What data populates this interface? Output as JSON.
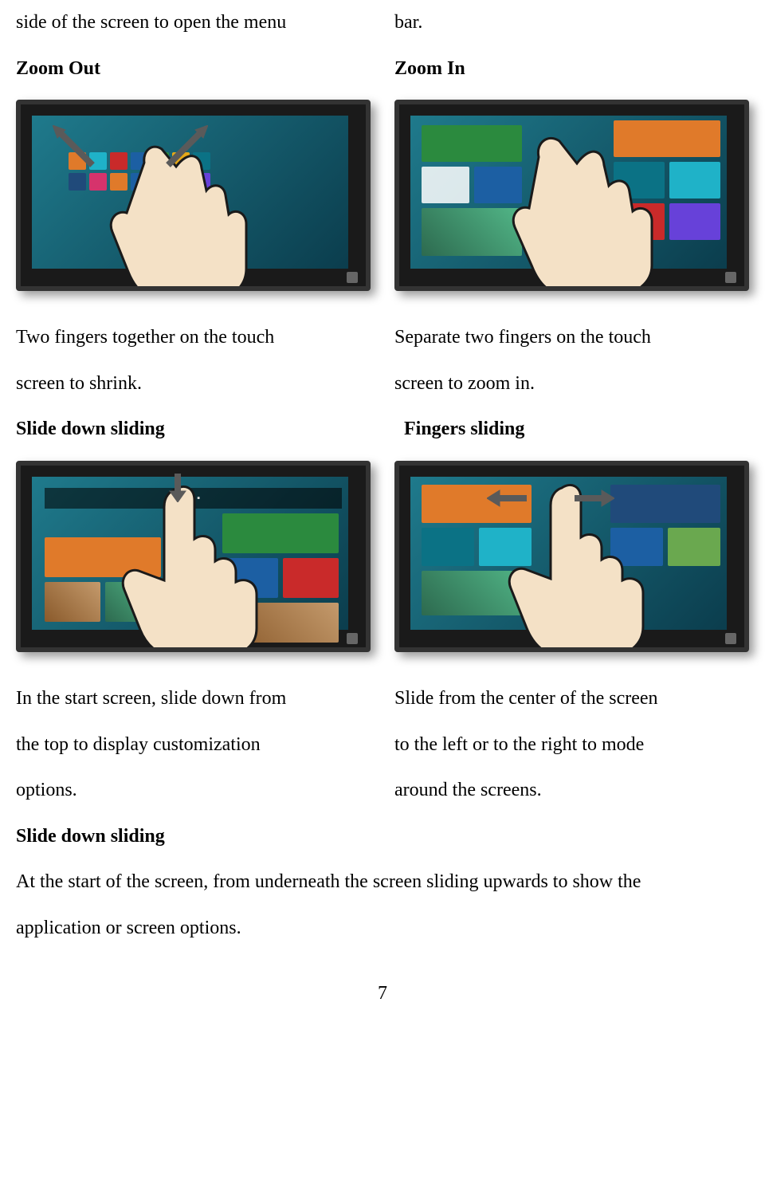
{
  "header": {
    "left": "side of the screen to open the menu",
    "right": "bar."
  },
  "section1": {
    "left_title": "Zoom Out",
    "right_title": "Zoom In",
    "left_desc_l1": "Two fingers together on the touch",
    "left_desc_l2": "screen to shrink.",
    "right_desc_l1": "Separate two fingers on the touch",
    "right_desc_l2": "screen to zoom in."
  },
  "section2": {
    "left_title": "Slide down sliding",
    "right_title": "Fingers sliding",
    "left_desc_l1": "In the start screen, slide down from",
    "left_desc_l2": "the top to display customization",
    "left_desc_l3": "options.",
    "right_desc_l1": "Slide from the center of the screen",
    "right_desc_l2": "to the left or to the right to mode",
    "right_desc_l3": "around the screens."
  },
  "section3": {
    "title": "Slide down sliding",
    "desc_l1": "At the start of the screen, from underneath the screen sliding upwards to show the",
    "desc_l2": "application or screen options."
  },
  "page_number": "7"
}
